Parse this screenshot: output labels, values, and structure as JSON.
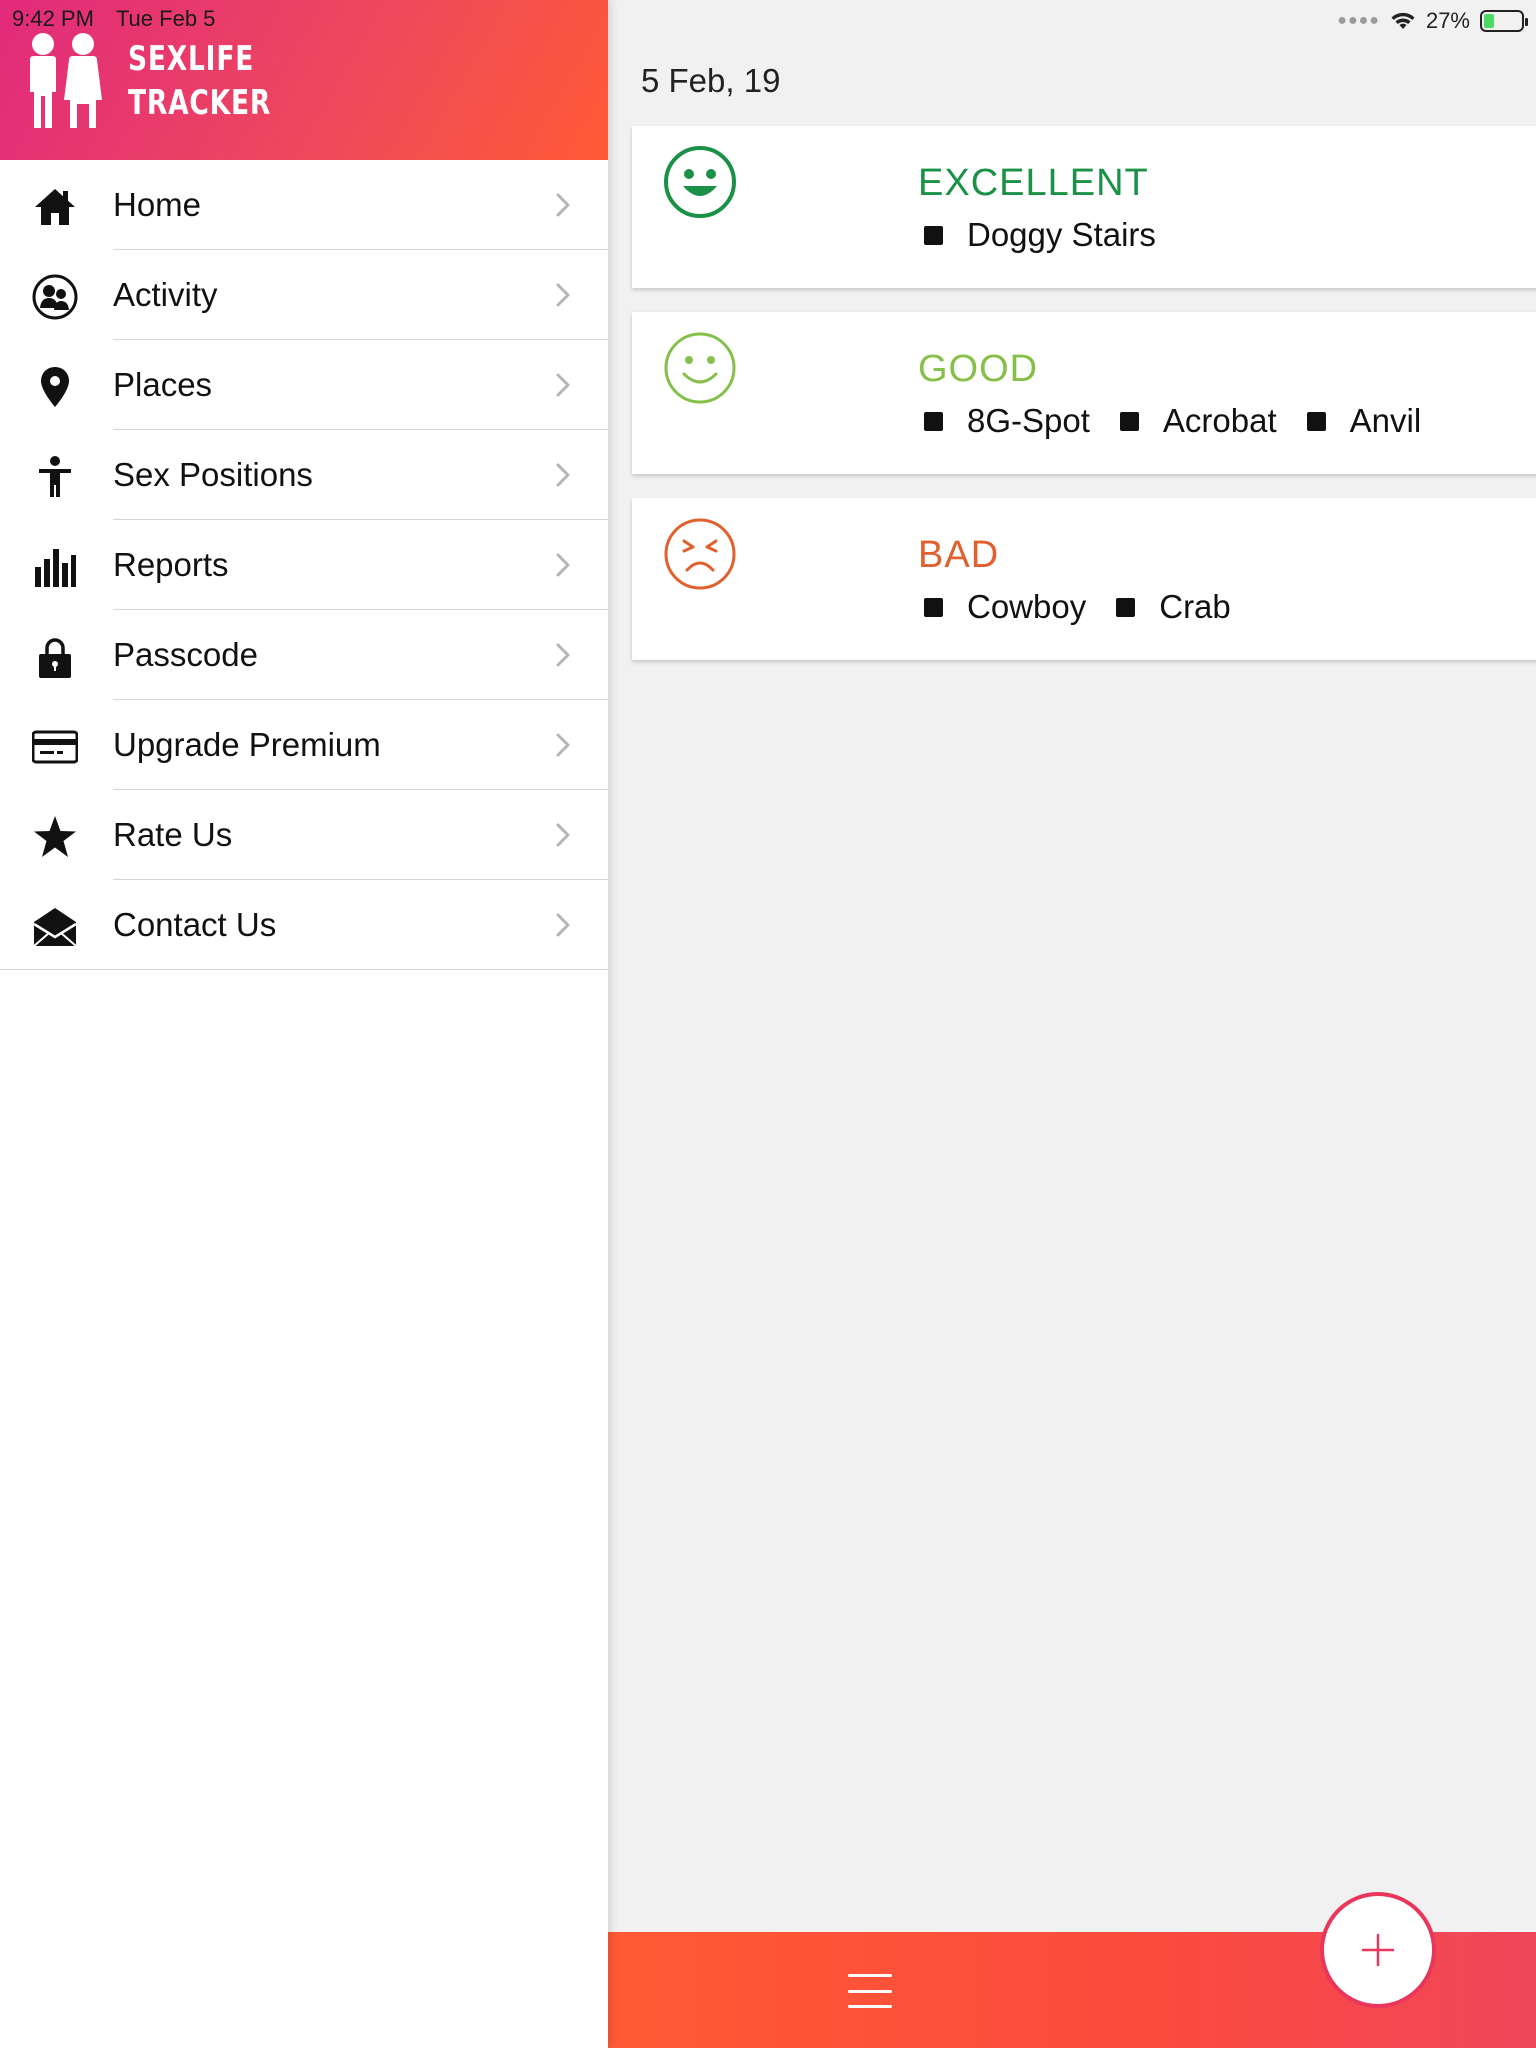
{
  "status_bar": {
    "time": "9:42 PM",
    "date": "Tue Feb 5",
    "battery": "27%",
    "battery_level": 0.27
  },
  "app": {
    "logo_line1": "SEXLIFE",
    "logo_line2": "TRACKER",
    "brand_gradient": [
      "#e12a7c",
      "#ff5a34"
    ]
  },
  "sidebar": {
    "items": [
      {
        "label": "Home",
        "icon": "home-icon"
      },
      {
        "label": "Activity",
        "icon": "couple-icon"
      },
      {
        "label": "Places",
        "icon": "map-pin-icon"
      },
      {
        "label": "Sex Positions",
        "icon": "person-icon"
      },
      {
        "label": "Reports",
        "icon": "bar-chart-icon"
      },
      {
        "label": "Passcode",
        "icon": "lock-icon"
      },
      {
        "label": "Upgrade Premium",
        "icon": "credit-card-icon"
      },
      {
        "label": "Rate Us",
        "icon": "star-icon"
      },
      {
        "label": "Contact Us",
        "icon": "envelope-icon"
      }
    ]
  },
  "main": {
    "date_heading": "5 Feb, 19",
    "entries": [
      {
        "rating": "EXCELLENT",
        "color": "#1b9147",
        "face": "big-smile-face-icon",
        "tags": [
          "Doggy Stairs"
        ]
      },
      {
        "rating": "GOOD",
        "color": "#86c04a",
        "face": "smile-face-icon",
        "tags": [
          "8G-Spot",
          "Acrobat",
          "Anvil"
        ]
      },
      {
        "rating": "BAD",
        "color": "#e0602e",
        "face": "angry-face-icon",
        "tags": [
          "Cowboy",
          "Crab"
        ]
      }
    ]
  },
  "bottom_bar": {
    "menu_icon": "hamburger-menu-icon",
    "add_icon": "plus-icon"
  }
}
